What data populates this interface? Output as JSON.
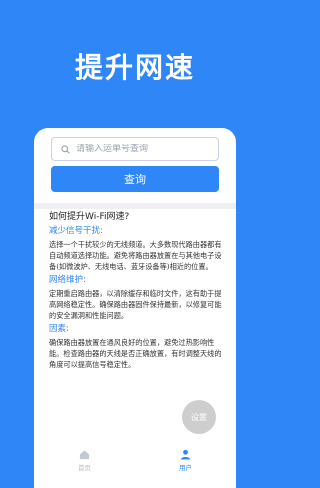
{
  "header": {
    "title": "提升网速"
  },
  "search": {
    "placeholder": "请输入运单号查询",
    "button_label": "查询"
  },
  "article": {
    "question": "如何提升Wi-Fi网速?",
    "sections": [
      {
        "heading": "减少信号干扰:",
        "body": "选择一个干扰较少的无线频道。大多数现代路由器都有自动频道选择功能。避免将路由器放置在与其他电子设备(如微波炉、无线电话、蓝牙设备等)相近的位置。"
      },
      {
        "heading": "网络维护:",
        "body": "定期重启路由器，以清除缓存和临时文件，这有助于提高网络稳定性。确保路由器固件保持最新，以修复可能的安全漏洞和性能问题。"
      },
      {
        "heading": "因素:",
        "body": "确保路由器放置在通风良好的位置，避免过热影响性能。检查路由器的天线是否正确放置，有时调整天线的角度可以提高信号稳定性。"
      }
    ]
  },
  "floating": {
    "settings_label": "设置"
  },
  "tabbar": {
    "tabs": [
      {
        "label": "首页"
      },
      {
        "label": "用户"
      }
    ]
  },
  "colors": {
    "primary": "#2f86f6",
    "inactive": "#b7bdc8"
  }
}
